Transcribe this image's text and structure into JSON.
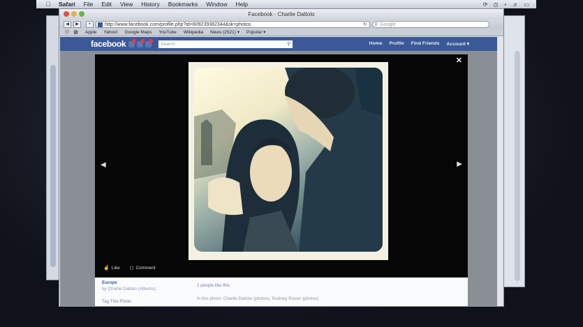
{
  "menubar": {
    "app": "Safari",
    "items": [
      "File",
      "Edit",
      "View",
      "History",
      "Bookmarks",
      "Window",
      "Help"
    ]
  },
  "browser": {
    "title": "Facebook - Charlie Dattolo",
    "url": "http://www.facebook.com/profile.php?id=609239382344&sk=photos",
    "search_placeholder": "Google",
    "bookmarks": [
      "Apple",
      "Yahoo!",
      "Google Maps",
      "YouTube",
      "Wikipedia",
      "News (2521) ▾",
      "Popular ▾"
    ]
  },
  "facebook": {
    "logo": "facebook",
    "search_placeholder": "Search",
    "nav": [
      "Home",
      "Profile",
      "Find Friends",
      "Account ▾"
    ]
  },
  "theater": {
    "like_label": "Like",
    "comment_label": "Comment"
  },
  "caption": {
    "album_title": "Europe",
    "byline": "by Charlie Dattolo (Albums)",
    "tag_link": "Tag This Photo",
    "likes": "2 people like this.",
    "in_photo": "In this photo: Charlie Dattolo (photos), Rodney Rosen (photos)"
  },
  "colors": {
    "facebook_blue": "#3b5998",
    "link_blue": "#6d84b4"
  }
}
